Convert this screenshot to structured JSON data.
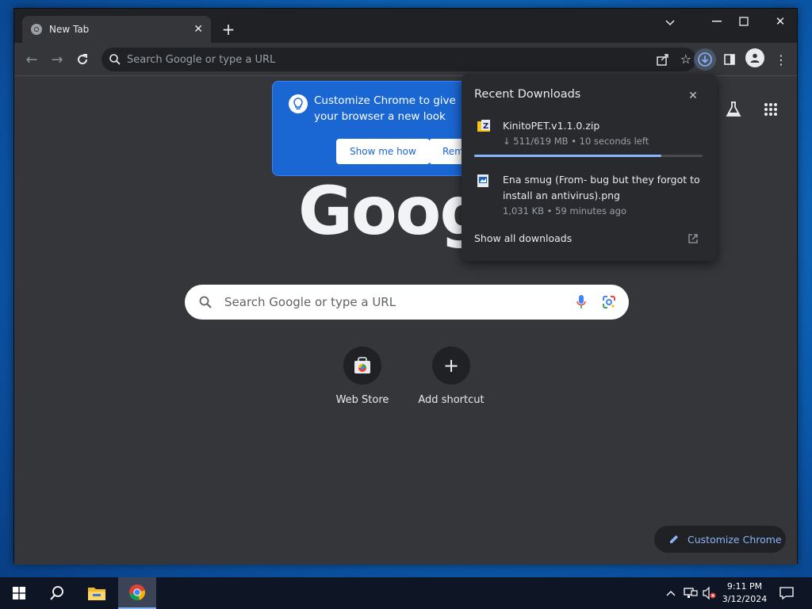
{
  "browser": {
    "tab_title": "New Tab",
    "omnibox_placeholder": "Search Google or type a URL"
  },
  "promo": {
    "text": "Customize Chrome to give your browser a new look",
    "primary_button": "Show me how",
    "secondary_button": "Remi"
  },
  "downloads": {
    "title": "Recent Downloads",
    "items": [
      {
        "name": "KinitoPET.v1.1.0.zip",
        "status": "↓ 511/619 MB • 10 seconds left",
        "progress_percent": 82
      },
      {
        "name": "Ena smug (From- bug but they forgot to install an antivirus).png",
        "status": "1,031 KB • 59 minutes ago"
      }
    ],
    "show_all": "Show all downloads"
  },
  "newtab": {
    "logo_text": "Google",
    "search_placeholder": "Search Google or type a URL",
    "shortcuts": [
      {
        "label": "Web Store"
      },
      {
        "label": "Add shortcut"
      }
    ],
    "customize_button": "Customize Chrome"
  },
  "taskbar": {
    "time": "9:11 PM",
    "date": "3/12/2024"
  },
  "colors": {
    "accent": "#8ab4f8",
    "promo_bg": "#1a66d2",
    "surface": "#35363a",
    "dark": "#202124"
  }
}
